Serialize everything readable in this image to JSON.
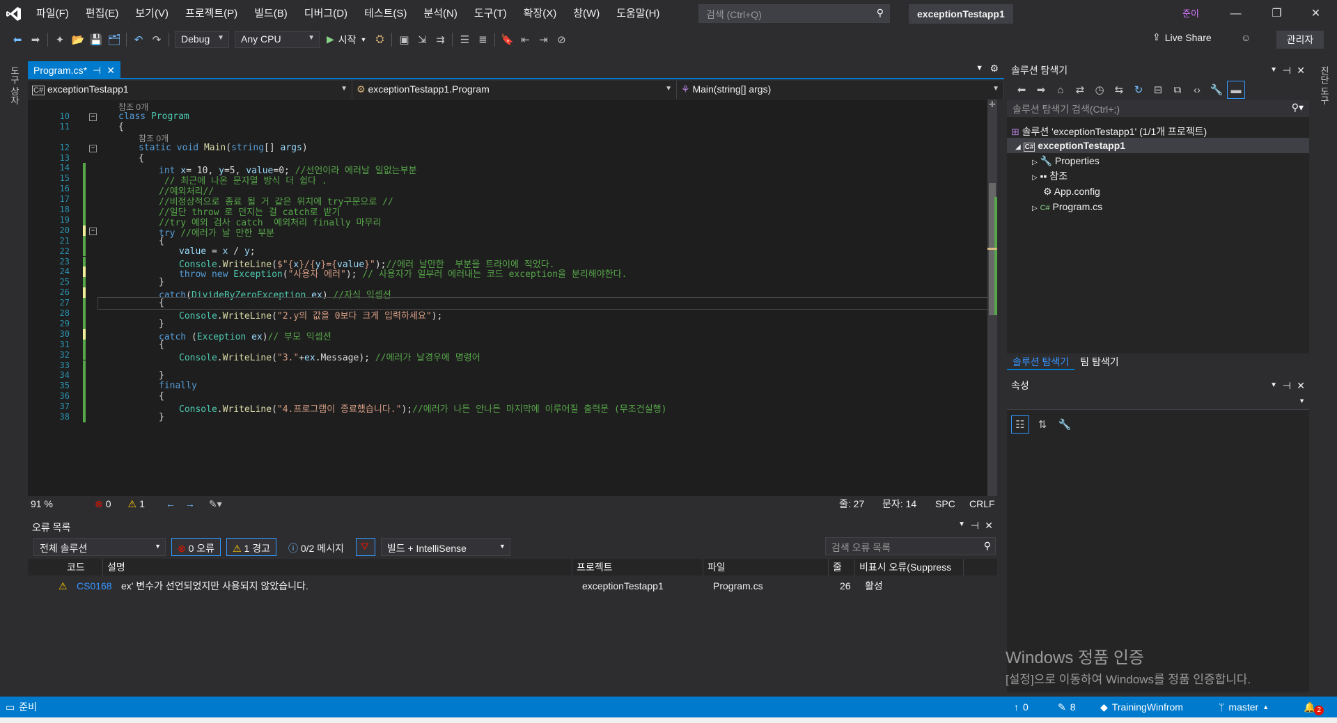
{
  "menu": [
    "파일(F)",
    "편집(E)",
    "보기(V)",
    "프로젝트(P)",
    "빌드(B)",
    "디버그(D)",
    "테스트(S)",
    "분석(N)",
    "도구(T)",
    "확장(X)",
    "창(W)",
    "도움말(H)"
  ],
  "quick_search_placeholder": "검색 (Ctrl+Q)",
  "window_title": "exceptionTestapp1",
  "user_initial": "준이",
  "toolbar": {
    "config": "Debug",
    "platform": "Any CPU",
    "start": "시작",
    "live_share": "Live Share",
    "admin": "관리자"
  },
  "left_vtabs": [
    "도구 상자"
  ],
  "right_vtabs": [
    "진단 도구"
  ],
  "doc_tab": "Program.cs*",
  "nav": {
    "project": "exceptionTestapp1",
    "class": "exceptionTestapp1.Program",
    "member": "Main(string[] args)"
  },
  "code_lines": [
    {
      "n": "",
      "lens": "참조 0개",
      "indent": 0
    },
    {
      "n": "10",
      "html": "<span class=\"kw\">class</span> <span class=\"ty\">Program</span>",
      "indent": 0
    },
    {
      "n": "11",
      "html": "{",
      "indent": 0
    },
    {
      "n": "",
      "lens": "참조 0개",
      "indent": 1
    },
    {
      "n": "12",
      "html": "<span class=\"kw\">static</span> <span class=\"kw\">void</span> <span class=\"fn\">Main</span>(<span class=\"kw\">string</span>[] <span class=\"id\">args</span>)",
      "indent": 1
    },
    {
      "n": "13",
      "html": "{",
      "indent": 1
    },
    {
      "n": "14",
      "html": "<span class=\"kw\">int</span> <span class=\"id\">x</span>= 10, <span class=\"id\">y</span>=5, <span class=\"id\">value</span>=0; <span class=\"cm\">//선언이라 에러날 일없는부분</span>",
      "indent": 2
    },
    {
      "n": "15",
      "html": " <span class=\"cm\">// 최근에 나온 문자열 방식 더 쉽다 .</span>",
      "indent": 2
    },
    {
      "n": "16",
      "html": "<span class=\"cm\">//예외처리//</span>",
      "indent": 2
    },
    {
      "n": "17",
      "html": "<span class=\"cm\">//비정상적으로 종료 될 거 같은 위치에 try구문으로 //</span>",
      "indent": 2
    },
    {
      "n": "18",
      "html": "<span class=\"cm\">//일단 throw 로 던지는 걸 catch로 받기</span>",
      "indent": 2
    },
    {
      "n": "19",
      "html": "<span class=\"cm\">//try 예외 검사 catch  예외처리 finally 마무리</span>",
      "indent": 2
    },
    {
      "n": "20",
      "html": "<span class=\"kw\">try</span> <span class=\"cm\">//에러가 날 만한 부분</span>",
      "indent": 2
    },
    {
      "n": "21",
      "html": "{",
      "indent": 2
    },
    {
      "n": "22",
      "html": "<span class=\"id\">value</span> = <span class=\"id\">x</span> / <span class=\"id\">y</span>;",
      "indent": 3
    },
    {
      "n": "23",
      "html": "<span class=\"ty\">Console</span>.<span class=\"fn\">WriteLine</span>(<span class=\"st\">$\"{</span><span class=\"id\">x</span><span class=\"st\">}/{</span><span class=\"id\">y</span><span class=\"st\">}={</span><span class=\"id\">value</span><span class=\"st\">}\"</span>);<span class=\"cm\">//에러 날만한  부분을 트라이에 적었다.</span>",
      "indent": 3
    },
    {
      "n": "24",
      "html": "<span class=\"kw\">throw</span> <span class=\"kw\">new</span> <span class=\"ty\">Exception</span>(<span class=\"st\">\"사용자 에러\"</span>); <span class=\"cm\">// 사용자가 일부러 에러내는 코드 exception을 분리해야한다.</span>",
      "indent": 3
    },
    {
      "n": "25",
      "html": "}",
      "indent": 2
    },
    {
      "n": "26",
      "html": "<span class=\"kw\">catch</span>(<span class=\"ty\">DivideByZeroException</span> <span class=\"id\">ex</span>) <span class=\"cm\">//자식 익셉션</span>",
      "indent": 2
    },
    {
      "n": "27",
      "html": "{",
      "indent": 2
    },
    {
      "n": "28",
      "html": "<span class=\"ty\">Console</span>.<span class=\"fn\">WriteLine</span>(<span class=\"st\">\"2.y의 값을 0보다 크게 입력하세요\"</span>);",
      "indent": 3
    },
    {
      "n": "29",
      "html": "}",
      "indent": 2
    },
    {
      "n": "30",
      "html": "<span class=\"kw\">catch</span> (<span class=\"ty\">Exception</span> <span class=\"id\">ex</span>)<span class=\"cm\">// 부모 익셉션</span>",
      "indent": 2
    },
    {
      "n": "31",
      "html": "{",
      "indent": 2
    },
    {
      "n": "32",
      "html": "<span class=\"ty\">Console</span>.<span class=\"fn\">WriteLine</span>(<span class=\"st\">\"3.\"</span>+<span class=\"id\">ex</span>.Message); <span class=\"cm\">//에러가 날경우에 명령어</span>",
      "indent": 3
    },
    {
      "n": "33",
      "html": "",
      "indent": 3
    },
    {
      "n": "34",
      "html": "}",
      "indent": 2
    },
    {
      "n": "35",
      "html": "<span class=\"kw\">finally</span>",
      "indent": 2
    },
    {
      "n": "36",
      "html": "{",
      "indent": 2
    },
    {
      "n": "37",
      "html": "<span class=\"ty\">Console</span>.<span class=\"fn\">WriteLine</span>(<span class=\"st\">\"4.프로그램이 종료했습니다.\"</span>);<span class=\"cm\">//에러가 나든 안나든 마지막에 이루어질 출력문 (무조건실행)</span>",
      "indent": 3
    },
    {
      "n": "38",
      "html": "}",
      "indent": 2
    }
  ],
  "editor_status": {
    "zoom": "91 %",
    "errors": "0",
    "warnings": "1",
    "line": "줄: 27",
    "col": "문자: 14",
    "spc": "SPC",
    "crlf": "CRLF"
  },
  "error_list": {
    "title": "오류 목록",
    "scope": "전체 솔루션",
    "errors_btn": "0 오류",
    "warnings_btn": "1 경고",
    "messages_btn": "0/2 메시지",
    "source": "빌드 + IntelliSense",
    "search_placeholder": "검색 오류 목록",
    "headers": [
      "코드",
      "설명",
      "프로젝트",
      "파일",
      "줄",
      "비표시 오류(Suppress"
    ],
    "rows": [
      {
        "code": "CS0168",
        "desc": "ex' 변수가 선언되었지만 사용되지 않았습니다.",
        "project": "exceptionTestapp1",
        "file": "Program.cs",
        "line": "26",
        "state": "활성"
      }
    ]
  },
  "solution": {
    "title": "솔루션 탐색기",
    "search_placeholder": "솔루션 탐색기 검색(Ctrl+;)",
    "items": [
      "솔루션 'exceptionTestapp1' (1/1개 프로젝트)",
      "exceptionTestapp1",
      "Properties",
      "참조",
      "App.config",
      "Program.cs"
    ],
    "tabs": [
      "솔루션 탐색기",
      "팀 탐색기"
    ]
  },
  "properties": {
    "title": "속성"
  },
  "activation": {
    "title": "Windows 정품 인증",
    "subtitle": "[설정]으로 이동하여 Windows를 정품 인증합니다."
  },
  "statusbar": {
    "ready": "준비",
    "up": "0",
    "pencil": "8",
    "repo": "TrainingWinfrom",
    "branch": "master",
    "notif": "2"
  }
}
